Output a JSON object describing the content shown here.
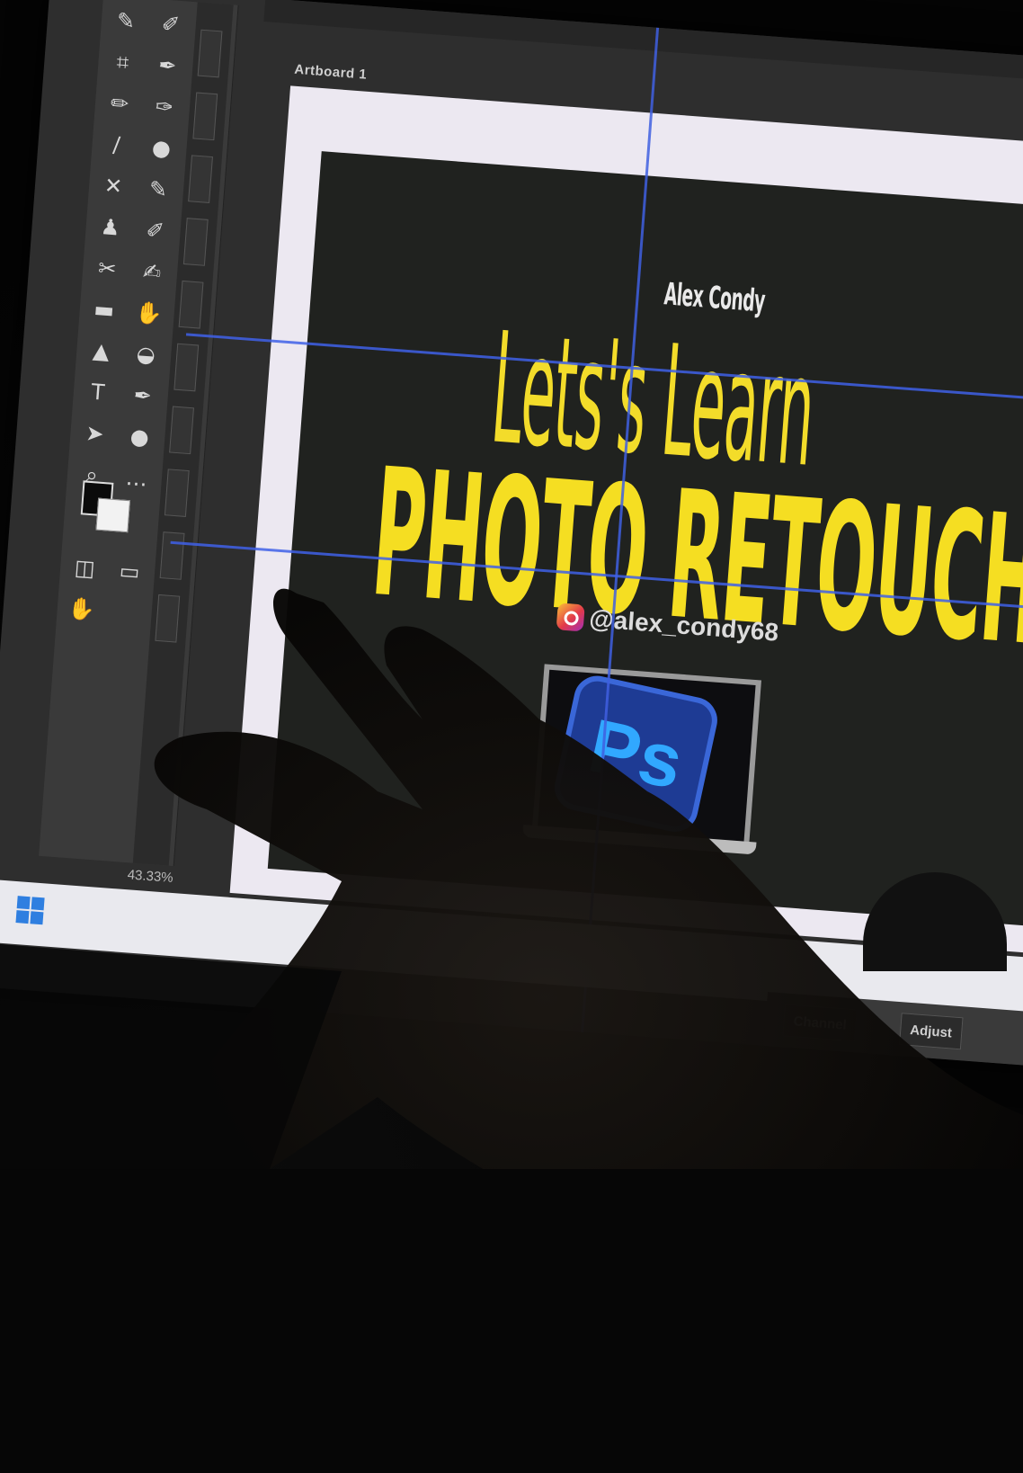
{
  "app": {
    "artboard_label": "Artboard 1",
    "zoom": "43.33%"
  },
  "design": {
    "author": "Alex Condy",
    "headline_line1": "Lets's Learn",
    "headline_line2": "PHOTO RETOUCH",
    "social_handle": "@alex_condy68",
    "logo_text": "Ps"
  },
  "panel_buttons": [
    "Channel",
    "Adjust"
  ],
  "colors": {
    "headline_yellow": "#F5DE22",
    "guide_blue": "#4060E8",
    "canvas_dark": "#20221F",
    "photoshop_blue": "#31A8FF"
  },
  "icons": [
    "lasso-icon",
    "crop-icon",
    "eyedropper-icon",
    "brush-icon",
    "stamp-icon",
    "eraser-icon",
    "gradient-icon",
    "shape-icon",
    "type-icon",
    "path-select-icon",
    "zoom-icon",
    "hand-icon",
    "windows-start-icon",
    "instagram-icon"
  ]
}
